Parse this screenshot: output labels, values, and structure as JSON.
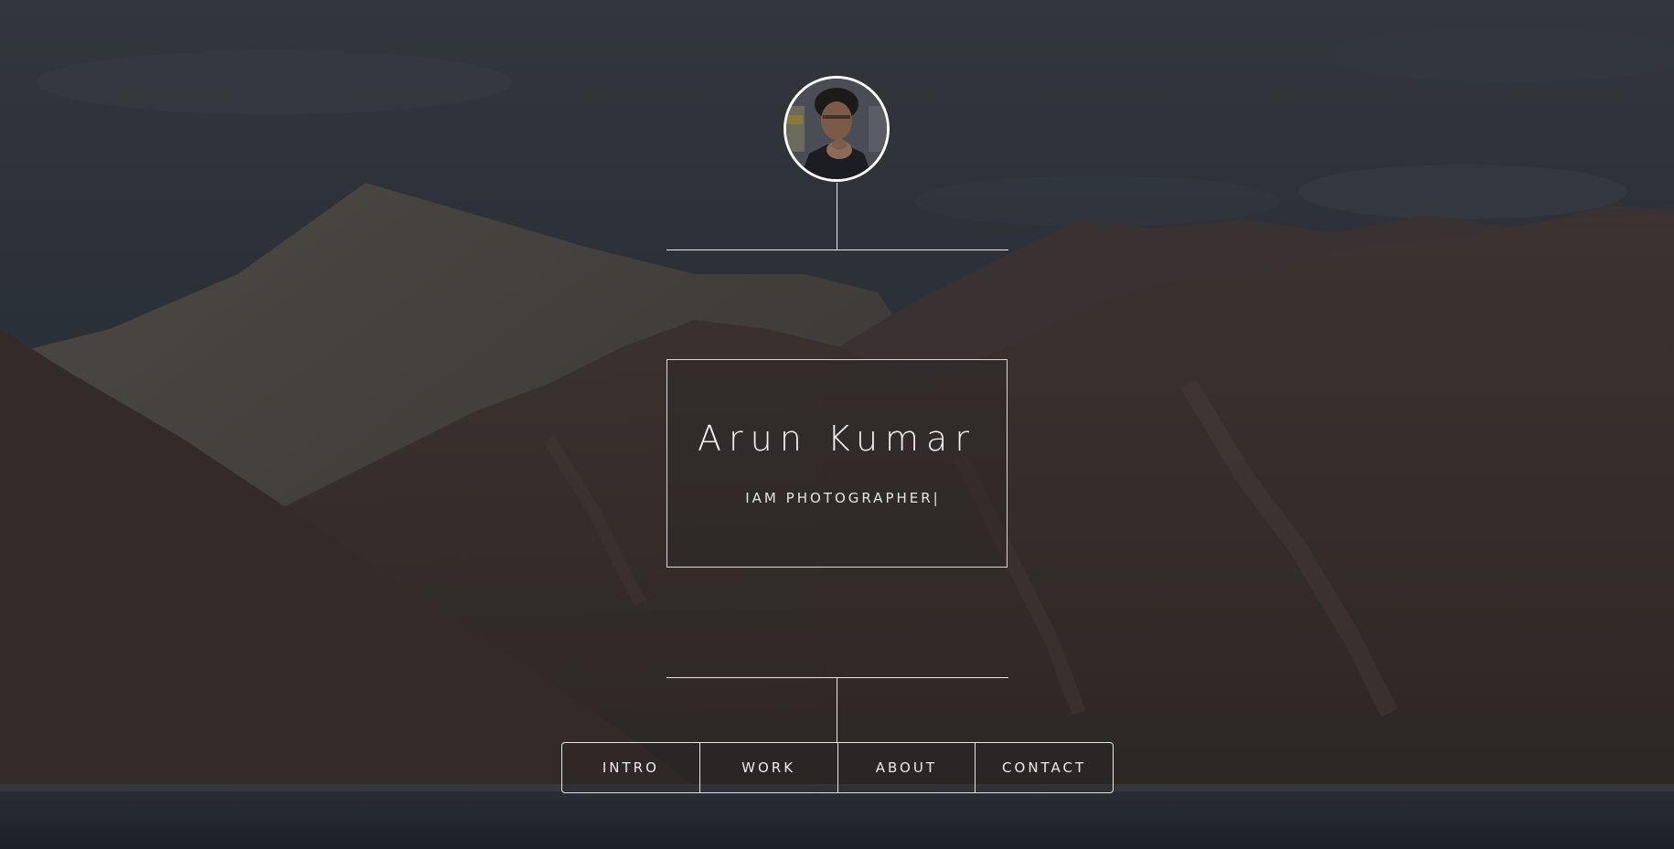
{
  "profile": {
    "name": "Arun Kumar",
    "tagline": "IAM PHOTOGRAPHER",
    "cursor": "|",
    "avatar_icon": "person-photo"
  },
  "nav": {
    "items": [
      {
        "label": "INTRO"
      },
      {
        "label": "WORK"
      },
      {
        "label": "ABOUT"
      },
      {
        "label": "CONTACT"
      }
    ]
  },
  "colors": {
    "sky": "#2e353f",
    "mountains": "#3e3432",
    "water": "#262b33",
    "lines": "#e8e8e8",
    "text": "#f2f2f2"
  }
}
